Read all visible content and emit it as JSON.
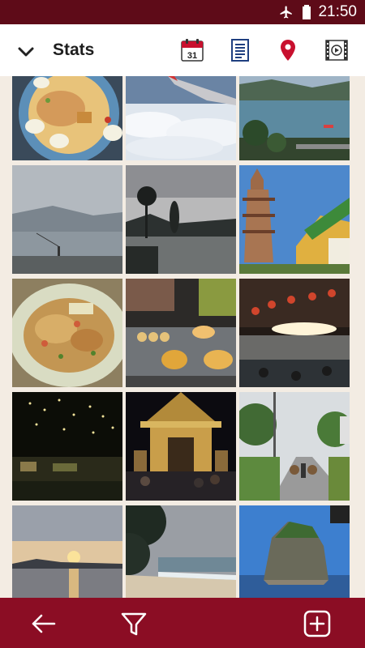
{
  "status_bar": {
    "time": "21:50"
  },
  "app_bar": {
    "title": "Stats",
    "calendar_day": "31"
  },
  "colors": {
    "brand_dark": "#5e0b18",
    "brand": "#8b0d24",
    "pin_red": "#c8102e",
    "icon_blue": "#1f3f80"
  },
  "icons": {
    "status": [
      "airplane-mode-icon",
      "battery-icon"
    ],
    "app_bar": [
      "chevron-down-icon",
      "calendar-icon",
      "list-document-icon",
      "map-pin-icon",
      "slideshow-icon"
    ],
    "bottom_bar": [
      "back-arrow-icon",
      "filter-icon",
      "add-icon"
    ]
  },
  "photos": [
    "thai-salad-dish",
    "clouds-from-airplane-window",
    "lake-with-boat",
    "misty-lake-fisherman",
    "lake-sunset-palm",
    "pagoda-temple",
    "pad-thai-plate",
    "street-food-stall",
    "night-market-lanterns",
    "night-string-lights",
    "golden-temple-night",
    "rural-road-walker",
    "sunset-over-sea",
    "tropical-beach",
    "limestone-island"
  ]
}
